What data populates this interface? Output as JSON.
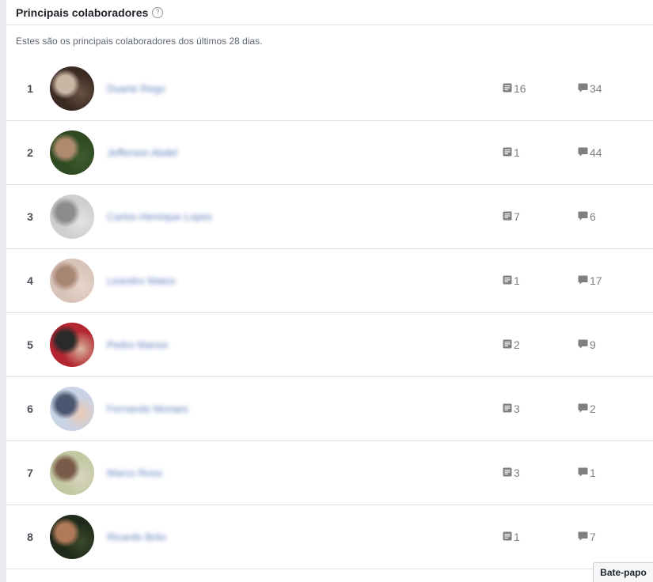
{
  "header": {
    "title": "Principais colaboradores",
    "help_icon": "question-circle-icon"
  },
  "subtitle": "Estes são os principais colaboradores dos últimos 28 dias.",
  "icons": {
    "posts": "post-document-icon",
    "comments": "comment-bubble-icon"
  },
  "contributors": [
    {
      "rank": "1",
      "name": "Duarte Rego",
      "posts": "16",
      "comments": "34",
      "avatar_colors": [
        "#3a2a22",
        "#c9b6a4",
        "#6a5244"
      ]
    },
    {
      "rank": "2",
      "name": "Jefferson Abdel",
      "posts": "1",
      "comments": "44",
      "avatar_colors": [
        "#2f4a22",
        "#b08a6e",
        "#3d5c2e"
      ]
    },
    {
      "rank": "3",
      "name": "Carlos Henrique Lopes",
      "posts": "7",
      "comments": "6",
      "avatar_colors": [
        "#cfcfcf",
        "#8c8c8c",
        "#e3e3e3"
      ]
    },
    {
      "rank": "4",
      "name": "Leandro Matos",
      "posts": "1",
      "comments": "17",
      "avatar_colors": [
        "#d8c3b8",
        "#a88674",
        "#e6d6cc"
      ]
    },
    {
      "rank": "5",
      "name": "Pedro Manso",
      "posts": "2",
      "comments": "9",
      "avatar_colors": [
        "#b3262f",
        "#2a2a2a",
        "#d9b5a0"
      ]
    },
    {
      "rank": "6",
      "name": "Fernando Moraes",
      "posts": "3",
      "comments": "2",
      "avatar_colors": [
        "#c8d3e6",
        "#4b5670",
        "#e8c7b2"
      ]
    },
    {
      "rank": "7",
      "name": "Marco Roso",
      "posts": "3",
      "comments": "1",
      "avatar_colors": [
        "#c2c9a2",
        "#7a5a48",
        "#d9d4bf"
      ]
    },
    {
      "rank": "8",
      "name": "Ricardo Brito",
      "posts": "1",
      "comments": "7",
      "avatar_colors": [
        "#1f2a1a",
        "#b07a5a",
        "#3c4a2c"
      ]
    }
  ],
  "chat_tab": {
    "label": "Bate-papo"
  }
}
